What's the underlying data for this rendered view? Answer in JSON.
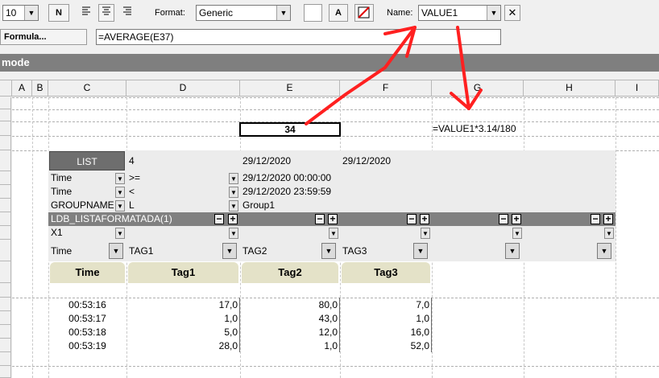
{
  "toolbar": {
    "font_size": "10",
    "normal_label": "N",
    "format_label": "Format:",
    "format_value": "Generic",
    "color_button_label": "A",
    "name_label": "Name:",
    "name_value": "VALUE1"
  },
  "formula_bar": {
    "button_label": "Formula...",
    "value": "=AVERAGE(E37)"
  },
  "mode_bar": {
    "label": "mode"
  },
  "columns": [
    "A",
    "B",
    "C",
    "D",
    "E",
    "F",
    "G",
    "H",
    "I"
  ],
  "cells": {
    "e_value": "34",
    "g_formula": "=VALUE1*3.14/180"
  },
  "list": {
    "button_label": "LIST",
    "count": "4",
    "date_from": "29/12/2020",
    "date_to": "29/12/2020",
    "filters": [
      {
        "field": "Time",
        "op": ">=",
        "value": "29/12/2020 00:00:00"
      },
      {
        "field": "Time",
        "op": "<",
        "value": "29/12/2020 23:59:59"
      },
      {
        "field": "GROUPNAME",
        "op": "L",
        "value": "Group1"
      }
    ],
    "format_name": "LDB_LISTAFORMATADA(1)",
    "x_field": "X1",
    "time_field": "Time",
    "tags": [
      "TAG1",
      "TAG2",
      "TAG3"
    ]
  },
  "table": {
    "headers": [
      "Time",
      "Tag1",
      "Tag2",
      "Tag3"
    ],
    "rows": [
      [
        "00:53:16",
        "17,0",
        "80,0",
        "7,0"
      ],
      [
        "00:53:17",
        "1,0",
        "43,0",
        "1,0"
      ],
      [
        "00:53:18",
        "5,0",
        "12,0",
        "16,0"
      ],
      [
        "00:53:19",
        "28,0",
        "1,0",
        "52,0"
      ]
    ]
  },
  "colors": {
    "mode_bar": "#7f7f7f",
    "list_bar": "#808080",
    "table_header": "#e4e2c8",
    "annotation_arrow": "#ff2020"
  }
}
